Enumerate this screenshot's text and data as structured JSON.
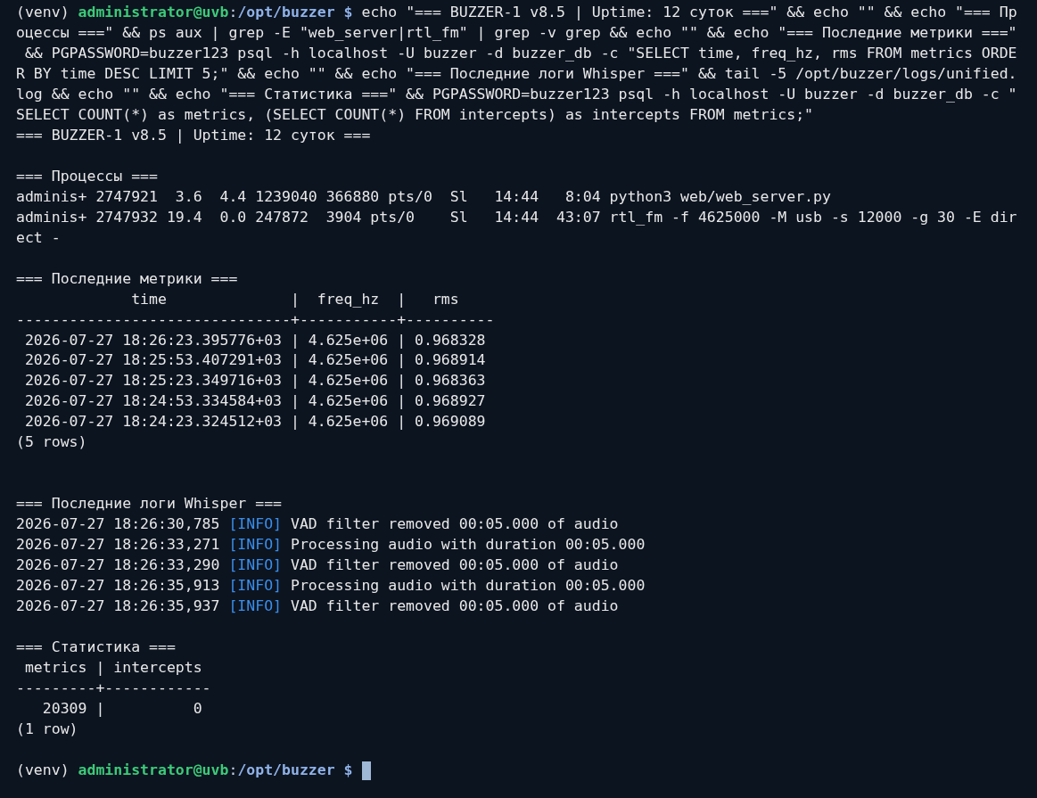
{
  "terminal": {
    "lines": [
      {
        "kind": "prompt",
        "venv": "(venv)",
        "user": "administrator@uvb",
        "separator": ":",
        "path": "/opt/buzzer",
        "symbol": "$",
        "command": " echo \"=== BUZZER-1 v8.5 | Uptime: 12 суток ===\" && echo \"\" && echo \"=== Пр"
      },
      {
        "kind": "text",
        "text": "оцессы ===\" && ps aux | grep -E \"web_server|rtl_fm\" | grep -v grep && echo \"\" && echo \"=== Последние метрики ===\""
      },
      {
        "kind": "text",
        "text": " && PGPASSWORD=buzzer123 psql -h localhost -U buzzer -d buzzer_db -c \"SELECT time, freq_hz, rms FROM metrics ORDE"
      },
      {
        "kind": "text",
        "text": "R BY time DESC LIMIT 5;\" && echo \"\" && echo \"=== Последние логи Whisper ===\" && tail -5 /opt/buzzer/logs/unified."
      },
      {
        "kind": "text",
        "text": "log && echo \"\" && echo \"=== Статистика ===\" && PGPASSWORD=buzzer123 psql -h localhost -U buzzer -d buzzer_db -c \""
      },
      {
        "kind": "text",
        "text": "SELECT COUNT(*) as metrics, (SELECT COUNT(*) FROM intercepts) as intercepts FROM metrics;\""
      },
      {
        "kind": "text",
        "text": "=== BUZZER-1 v8.5 | Uptime: 12 суток ==="
      },
      {
        "kind": "blank"
      },
      {
        "kind": "text",
        "text": "=== Процессы ==="
      },
      {
        "kind": "text",
        "text": "adminis+ 2747921  3.6  4.4 1239040 366880 pts/0  Sl   14:44   8:04 python3 web/web_server.py"
      },
      {
        "kind": "text",
        "text": "adminis+ 2747932 19.4  0.0 247872  3904 pts/0    Sl   14:44  43:07 rtl_fm -f 4625000 -M usb -s 12000 -g 30 -E dir"
      },
      {
        "kind": "text",
        "text": "ect -"
      },
      {
        "kind": "blank"
      },
      {
        "kind": "text",
        "text": "=== Последние метрики ==="
      },
      {
        "kind": "text",
        "text": "             time              |  freq_hz  |   rms"
      },
      {
        "kind": "text",
        "text": "-------------------------------+-----------+----------"
      },
      {
        "kind": "text",
        "text": " 2026-07-27 18:26:23.395776+03 | 4.625e+06 | 0.968328"
      },
      {
        "kind": "text",
        "text": " 2026-07-27 18:25:53.407291+03 | 4.625e+06 | 0.968914"
      },
      {
        "kind": "text",
        "text": " 2026-07-27 18:25:23.349716+03 | 4.625e+06 | 0.968363"
      },
      {
        "kind": "text",
        "text": " 2026-07-27 18:24:53.334584+03 | 4.625e+06 | 0.968927"
      },
      {
        "kind": "text",
        "text": " 2026-07-27 18:24:23.324512+03 | 4.625e+06 | 0.969089"
      },
      {
        "kind": "text",
        "text": "(5 rows)"
      },
      {
        "kind": "blank"
      },
      {
        "kind": "blank"
      },
      {
        "kind": "text",
        "text": "=== Последние логи Whisper ==="
      },
      {
        "kind": "log",
        "timestamp": "2026-07-27 18:26:30,785",
        "level": "[INFO]",
        "message": "VAD filter removed 00:05.000 of audio"
      },
      {
        "kind": "log",
        "timestamp": "2026-07-27 18:26:33,271",
        "level": "[INFO]",
        "message": "Processing audio with duration 00:05.000"
      },
      {
        "kind": "log",
        "timestamp": "2026-07-27 18:26:33,290",
        "level": "[INFO]",
        "message": "VAD filter removed 00:05.000 of audio"
      },
      {
        "kind": "log",
        "timestamp": "2026-07-27 18:26:35,913",
        "level": "[INFO]",
        "message": "Processing audio with duration 00:05.000"
      },
      {
        "kind": "log",
        "timestamp": "2026-07-27 18:26:35,937",
        "level": "[INFO]",
        "message": "VAD filter removed 00:05.000 of audio"
      },
      {
        "kind": "blank"
      },
      {
        "kind": "text",
        "text": "=== Статистика ==="
      },
      {
        "kind": "text",
        "text": " metrics | intercepts"
      },
      {
        "kind": "text",
        "text": "---------+------------"
      },
      {
        "kind": "text",
        "text": "   20309 |          0"
      },
      {
        "kind": "text",
        "text": "(1 row)"
      },
      {
        "kind": "blank"
      },
      {
        "kind": "prompt",
        "venv": "(venv)",
        "user": "administrator@uvb",
        "separator": ":",
        "path": "/opt/buzzer",
        "symbol": "$",
        "cursor": true
      }
    ]
  }
}
